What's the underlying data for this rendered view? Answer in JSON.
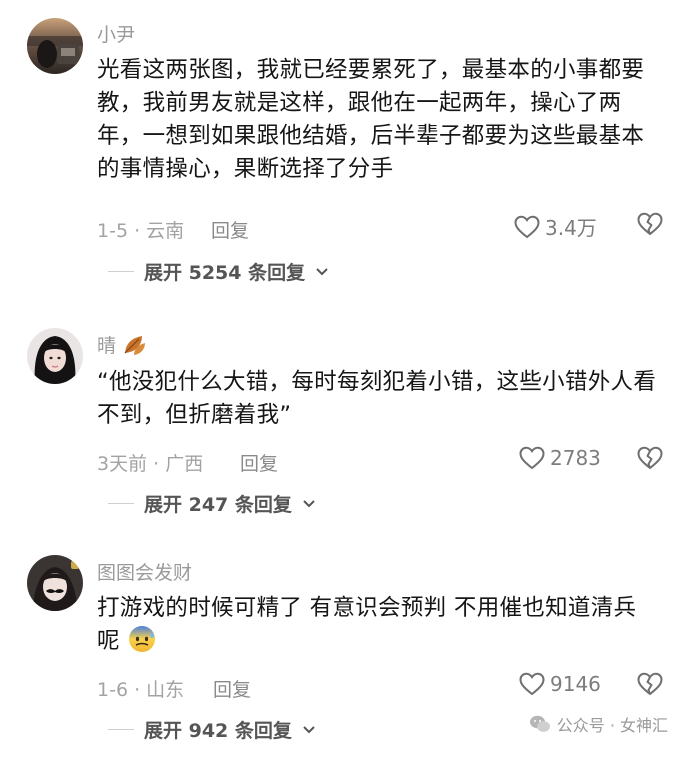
{
  "comments": [
    {
      "username": "小尹",
      "text": "光看这两张图，我就已经要累死了，最基本的小事都要教，我前男友就是这样，跟他在一起两年，操心了两年，一想到如果跟他结婚，后半辈子都要为这些最基本的事情操心，果断选择了分手",
      "date_location": "1-5 · 云南",
      "reply_label": "回复",
      "likes": "3.4万",
      "expand_label": "展开 5254 条回复",
      "avatar_icon": "avatar-photo-dark-car"
    },
    {
      "username": "晴",
      "username_emoji": "fallen-leaf-emoji",
      "text": "“他没犯什么大错，每时每刻犯着小错，这些小错外人看不到，但折磨着我”",
      "date_location": "3天前 · 广西",
      "reply_label": "回复",
      "likes": "2783",
      "expand_label": "展开 247 条回复",
      "avatar_icon": "avatar-photo-girl"
    },
    {
      "username": "图图会发财",
      "text": "打游戏的时候可精了 有意识会预判 不用催也知道清兵呢",
      "text_emoji": "sweating-face-emoji",
      "date_location": "1-6 · 山东",
      "reply_label": "回复",
      "likes": "9146",
      "expand_label": "展开 942 条回复",
      "avatar_icon": "avatar-photo-mustache"
    }
  ],
  "watermark": {
    "text": "公众号 · 女神汇",
    "icon": "wechat-icon"
  },
  "colors": {
    "text": "#161616",
    "meta": "#a3a3a3",
    "username": "#9a9a9a",
    "divider": "#cfcfcf"
  }
}
